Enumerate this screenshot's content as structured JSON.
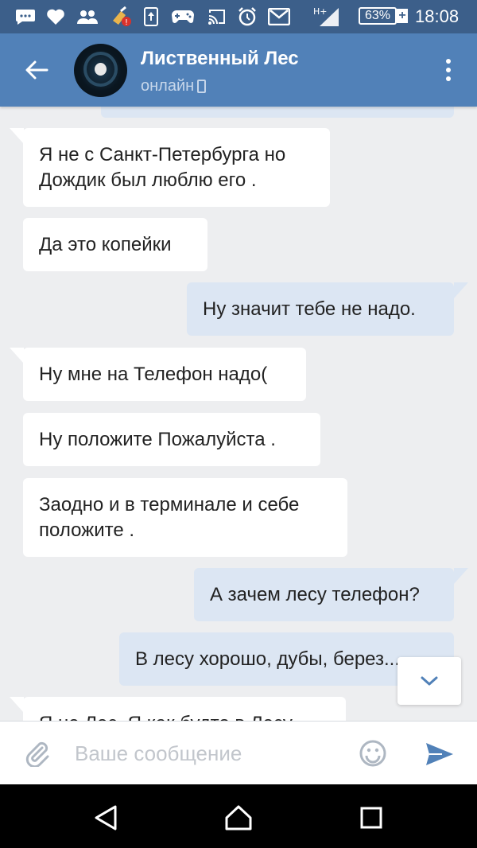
{
  "status_bar": {
    "battery": "63%",
    "battery_plus": "+",
    "network": "H+",
    "time": "18:08",
    "icons": [
      "message-icon",
      "heart-icon",
      "people-icon",
      "broom-icon",
      "sim-upload-icon",
      "gamepad-icon",
      "cast-icon",
      "alarm-icon",
      "gmail-icon",
      "signal-icon"
    ]
  },
  "header": {
    "title": "Лиственный Лес",
    "status": "онлайн"
  },
  "messages": [
    {
      "direction": "out",
      "text": ""
    },
    {
      "direction": "in",
      "text": "Я не с Санкт-Петербурга но Дождик был люблю его ."
    },
    {
      "direction": "in",
      "text": "Да это копейки"
    },
    {
      "direction": "out",
      "text": "Ну значит тебе не надо."
    },
    {
      "direction": "in",
      "text": "Ну мне на Телефон надо("
    },
    {
      "direction": "in",
      "text": "Ну положите Пожалуйста ."
    },
    {
      "direction": "in",
      "text": "Заодно и в терминале и себе положите ."
    },
    {
      "direction": "out",
      "text": "А зачем лесу телефон?"
    },
    {
      "direction": "out",
      "text": "В лесу хорошо, дубы, берез..."
    },
    {
      "direction": "in",
      "text": "Я не Лес. Я как будто в Лесу"
    }
  ],
  "composer": {
    "placeholder": "Ваше сообщение"
  },
  "colors": {
    "status_bar": "#3c5f8a",
    "header": "#5181b8",
    "background": "#edeef0",
    "incoming_bubble": "#ffffff",
    "outgoing_bubble": "#dce6f3",
    "accent": "#5181b8"
  }
}
